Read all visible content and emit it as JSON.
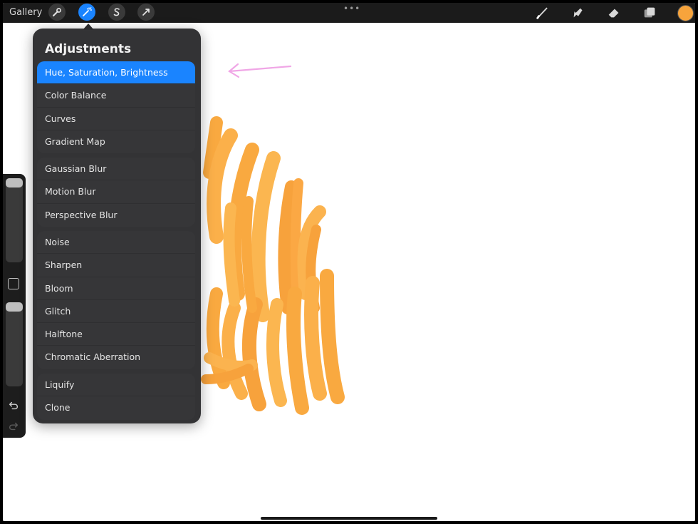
{
  "topbar": {
    "gallery_label": "Gallery",
    "left_tools": [
      "wrench-icon",
      "magic-wand-icon",
      "selection-s-icon",
      "arrow-transform-icon"
    ],
    "active_tool": "magic-wand-icon",
    "right_tools": [
      "brush-icon",
      "smudge-icon",
      "eraser-icon",
      "layers-icon"
    ],
    "current_color": "#f7a43c"
  },
  "adjustments": {
    "title": "Adjustments",
    "groups": [
      {
        "items": [
          "Hue, Saturation, Brightness",
          "Color Balance",
          "Curves",
          "Gradient Map"
        ]
      },
      {
        "items": [
          "Gaussian Blur",
          "Motion Blur",
          "Perspective Blur"
        ]
      },
      {
        "items": [
          "Noise",
          "Sharpen",
          "Bloom",
          "Glitch",
          "Halftone",
          "Chromatic Aberration"
        ]
      },
      {
        "items": [
          "Liquify",
          "Clone"
        ]
      }
    ],
    "selected": "Hue, Saturation, Brightness"
  },
  "colors": {
    "accent": "#1a84ff",
    "stroke_orange": "#f9a940",
    "annotation_arrow": "#f0a6e6"
  },
  "sidebar": {
    "size_slider_value": 0.0,
    "opacity_slider_value": 0.0
  }
}
